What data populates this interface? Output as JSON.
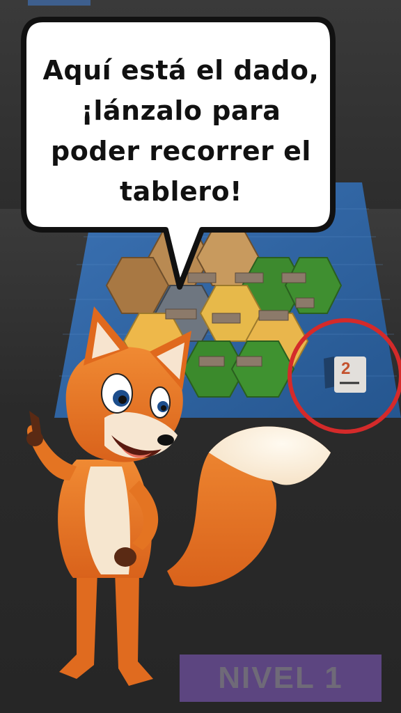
{
  "dialog": {
    "line1": "Aquí está el dado,",
    "line2": "¡lánzalo para",
    "line3": "poder recorrer el",
    "line4": "tablero!"
  },
  "dice": {
    "face_value": "2"
  },
  "level": {
    "label": "NIVEL 1"
  },
  "colors": {
    "water": "#2f66a8",
    "highlight_ring": "#d42a2a",
    "fox_orange": "#ec7a24",
    "level_badge": "#5c4580"
  },
  "icons": [
    "fox-mascot",
    "speech-bubble",
    "dice-icon",
    "highlight-circle",
    "hex-tile"
  ]
}
